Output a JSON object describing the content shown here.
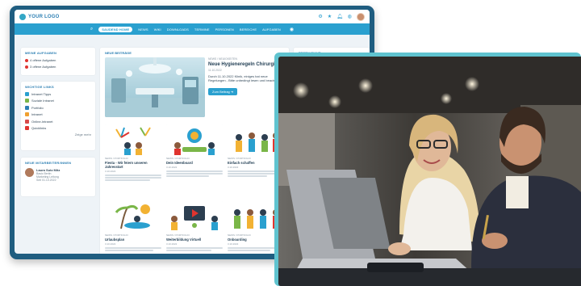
{
  "intranet": {
    "logo_text": "YOUR LOGO",
    "nav": {
      "items": [
        "SAUDEND HOME",
        "NEWS",
        "WIKI",
        "DOWNLOADS",
        "TERMINE",
        "PERSONEN",
        "BEREICHE",
        "AUFGABEN"
      ]
    },
    "open_tasks": {
      "title": "MEINE AUFGABEN",
      "items": [
        "4 offene Aufgaben",
        "3 offene Aufgaben"
      ]
    },
    "quick_links": {
      "title": "WICHTIGE LINKS",
      "items": [
        "Intranet Tipps",
        "Soziale Intranet",
        "Portfolio",
        "Intranet",
        "Online-Intranet",
        "Quicklinks"
      ],
      "colors": [
        "#2aa0cf",
        "#7ab648",
        "#2c7fb3",
        "#f0a030",
        "#d84a4a",
        "#e0342f"
      ],
      "more": "Zeige mehr"
    },
    "new_colleagues": {
      "title": "NEUE MITARBEITER/INNEN",
      "person_name": "Laura Sutz Mitz",
      "person_line1": "Basic Berlin",
      "person_line2": "Marketing Leitung",
      "person_line3": "Seit 01.10.2022"
    },
    "news": {
      "title": "NEUE BEITRÄGE",
      "featured": {
        "meta": "NEWS / NEUIGKEITEN",
        "headline": "Neue Hygieneregeln Chirurgie",
        "date": "11.10.2022",
        "body": "Durch 11.10.2022 Klinik, einiges hat neue Regelungen - Bitte unbedingt lesen und beachten",
        "button": "Zum Beitrag"
      },
      "tiles": [
        {
          "meta": "NEWS / PORTFOLIO",
          "title": "Fiesta - Wir feiern unseren Jahresstart",
          "sub": "3.10.2022"
        },
        {
          "meta": "NEWS / PORTFOLIO",
          "title": "Dein Ideenboard",
          "sub": "3.10.2022"
        },
        {
          "meta": "NEWS / PORTFOLIO",
          "title": "Einfach schaffen",
          "sub": "3.10.2022"
        },
        {
          "meta": "NEWS / PORTFOLIO",
          "title": "Urlaubsplan",
          "sub": "3.10.2022"
        },
        {
          "meta": "NEWS / PORTFOLIO",
          "title": "Weiterbildung Virtuell",
          "sub": "3.10.2022"
        },
        {
          "meta": "NEWS / PORTFOLIO",
          "title": "Onboarding",
          "sub": "3.10.2022"
        }
      ]
    },
    "right_card_title": "RESTAURANT"
  },
  "photo": {
    "description_icon": "office-photo",
    "accent": "#5fc3cf"
  }
}
